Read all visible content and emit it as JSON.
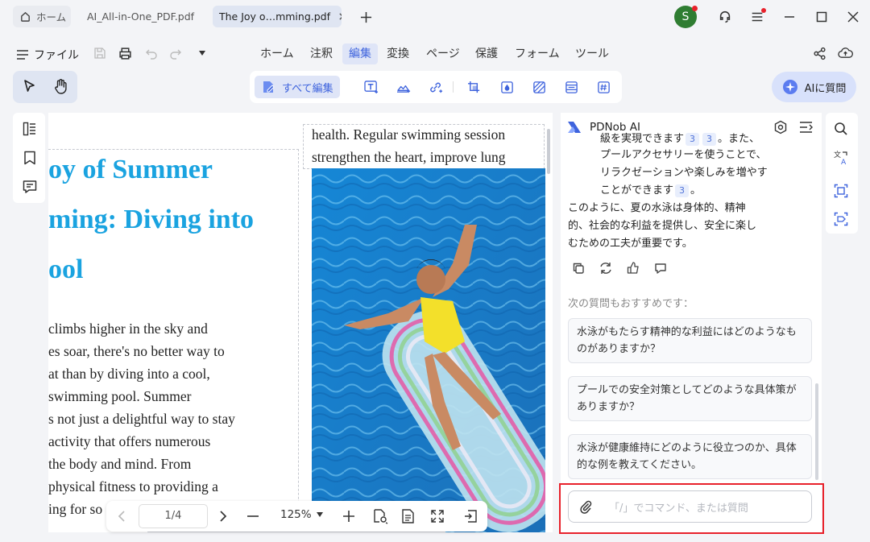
{
  "tabs": [
    {
      "label": "ホーム"
    },
    {
      "label": "AI_All-in-One_PDF.pdf"
    },
    {
      "label": "The Joy o…mming.pdf"
    }
  ],
  "account": {
    "initial": "S"
  },
  "menu": {
    "file": "ファイル",
    "items": [
      "ホーム",
      "注釈",
      "編集",
      "変換",
      "ページ",
      "保護",
      "フォーム",
      "ツール"
    ],
    "active_index": 2
  },
  "toolbar": {
    "edit_all": "すべて編集"
  },
  "ai_button": "AIに質問",
  "doc": {
    "title_lines": [
      "oy of Summer",
      "ming: Diving into",
      "ool"
    ],
    "left_lines": [
      "climbs higher in the sky and",
      "es soar, there's no better way to",
      "at than by diving into a cool,",
      "swimming pool. Summer",
      "s not just a delightful way to stay",
      " activity that offers numerous",
      " the body and mind. From",
      "physical fitness to providing a",
      "ing for so"
    ],
    "right_lines": [
      "health. Regular swimming session",
      "strengthen the heart, improve lung"
    ]
  },
  "pagenav": {
    "page": "1/4",
    "zoom": "125%"
  },
  "ai": {
    "title": "PDNob AI",
    "answer_lines": [
      {
        "text": "級を実現できます",
        "cites": [
          "3",
          "3"
        ],
        "tail": "。また、"
      },
      {
        "text": "プールアクセサリーを使うことで、",
        "cites": [],
        "tail": ""
      },
      {
        "text": "リラクゼーションや楽しみを増やす",
        "cites": [],
        "tail": ""
      },
      {
        "text": "ことができます",
        "cites": [
          "3"
        ],
        "tail": "。"
      }
    ],
    "summary_lines": [
      "このように、夏の水泳は身体的、精神",
      "的、社会的な利益を提供し、安全に楽し",
      "むための工夫が重要です。"
    ],
    "suggest_heading": "次の質問もおすすめです：",
    "suggestions": [
      "水泳がもたらす精神的な利益にはどのようなものがありますか？",
      "プールでの安全対策としてどのような具体策がありますか？",
      "水泳が健康維持にどのように役立つのか、具体的な例を教えてください。"
    ],
    "input_placeholder": "「/」でコマンド、または質問"
  },
  "colors": {
    "accent": "#3e63dd",
    "title_blue": "#1aa3e0",
    "highlight_red": "#e8212b",
    "pool_blue": "#1b7fc9"
  }
}
